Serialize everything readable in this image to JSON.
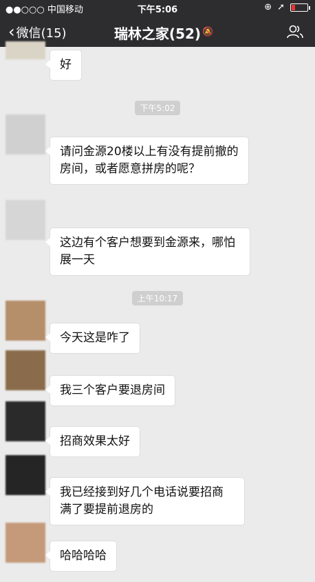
{
  "status": {
    "carrier": "●●○○○ 中国移动",
    "time": "下午5:06"
  },
  "header": {
    "back_label": "微信(15)",
    "title": "瑞林之家(52)",
    "muted": true
  },
  "messages": [
    {
      "kind": "text",
      "text": "好"
    },
    {
      "kind": "time",
      "text": "下午5:02"
    },
    {
      "kind": "text",
      "nick": "",
      "text": "请问金源20楼以上有没有提前撤的房间，或者愿意拼房的呢？"
    },
    {
      "kind": "text",
      "nick": "",
      "text": "这边有个客户想要到金源来，哪怕展一天"
    },
    {
      "kind": "time",
      "text": "上午10:17"
    },
    {
      "kind": "text",
      "text": "今天这是咋了"
    },
    {
      "kind": "text",
      "text": "我三个客户要退房间"
    },
    {
      "kind": "text",
      "text": "招商效果太好"
    },
    {
      "kind": "text",
      "text": "我已经接到好几个电话说要招商满了要提前退房的"
    },
    {
      "kind": "text",
      "text": "哈哈哈哈"
    }
  ],
  "colors": {
    "nav_bg": "#2d2d2f",
    "chat_bg": "#ebebeb",
    "bubble_bg": "#ffffff"
  }
}
